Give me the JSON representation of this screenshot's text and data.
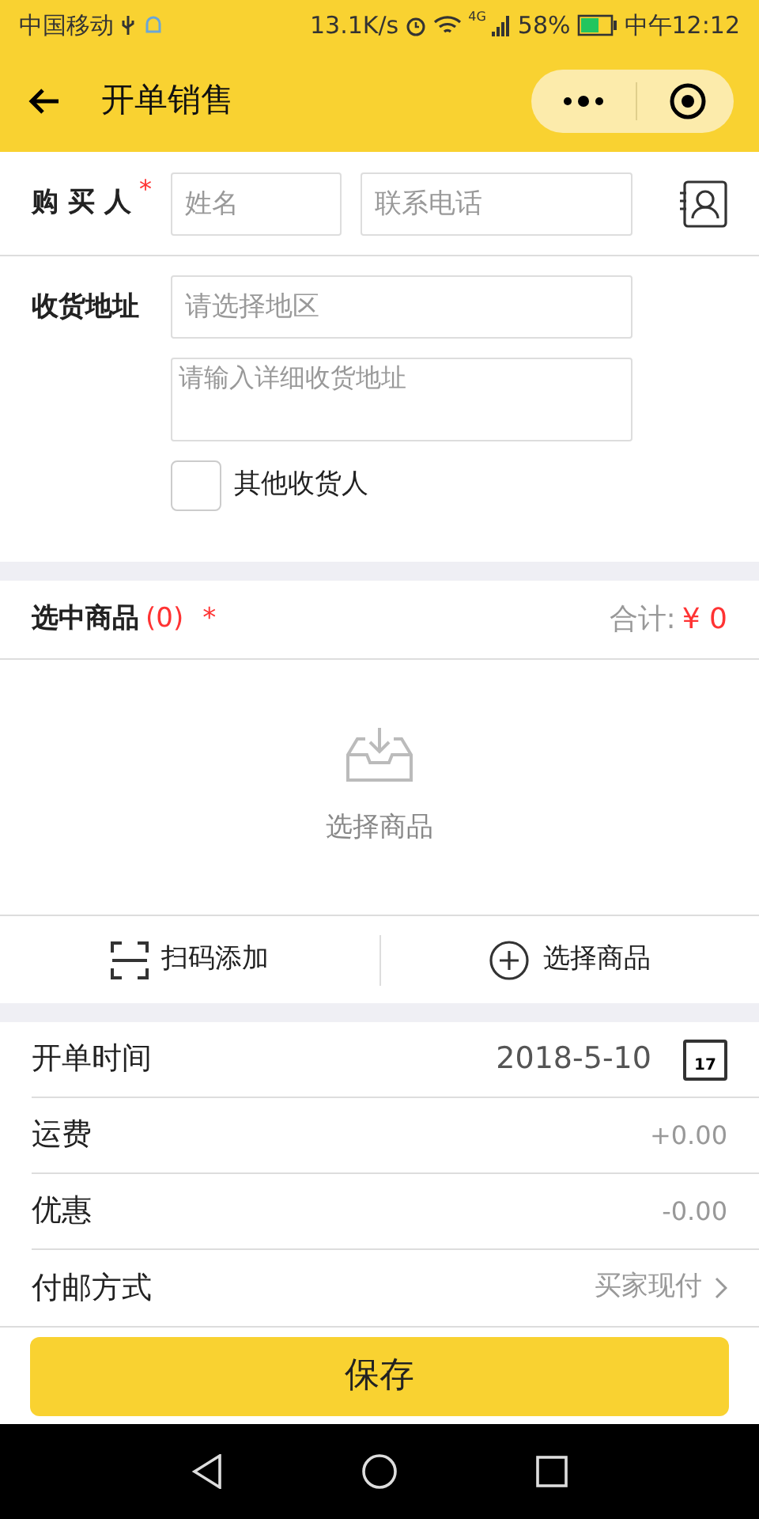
{
  "status_bar": {
    "carrier": "中国移动",
    "speed": "13.1K/s",
    "network": "4G",
    "battery": "58%",
    "time": "中午12:12"
  },
  "header": {
    "title": "开单销售"
  },
  "buyer": {
    "label": "购 买 人",
    "required": "*",
    "name_placeholder": "姓名",
    "phone_placeholder": "联系电话"
  },
  "address": {
    "label": "收货地址",
    "region_placeholder": "请选择地区",
    "detail_placeholder": "请输入详细收货地址",
    "other_receiver": {
      "label": "其他收货人",
      "checked": false
    }
  },
  "products": {
    "title": "选中商品",
    "count": "(0)",
    "required": "*",
    "total_label": "合计:",
    "total_value": "¥ 0",
    "empty_text": "选择商品"
  },
  "actions": [
    {
      "kind": "scan",
      "label": "扫码添加"
    },
    {
      "kind": "add",
      "label": "选择商品"
    }
  ],
  "fields": [
    {
      "kind": "date",
      "label": "开单时间",
      "value": "2018-5-10",
      "calendar_day": "17"
    },
    {
      "kind": "plain",
      "label": "运费",
      "value": "+0.00"
    },
    {
      "kind": "plain",
      "label": "优惠",
      "value": "-0.00"
    },
    {
      "kind": "link",
      "label": "付邮方式",
      "value": "买家现付"
    }
  ],
  "save_button": "保存"
}
